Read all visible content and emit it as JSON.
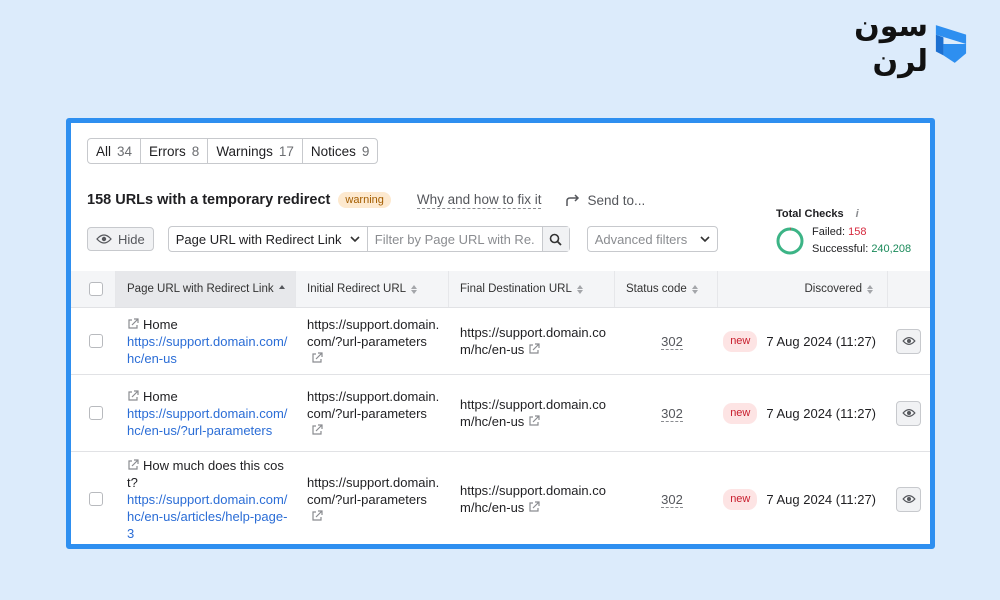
{
  "logo": {
    "text": "سون لرن"
  },
  "tabs": [
    {
      "label": "All",
      "count": "34"
    },
    {
      "label": "Errors",
      "count": "8"
    },
    {
      "label": "Warnings",
      "count": "17"
    },
    {
      "label": "Notices",
      "count": "9"
    }
  ],
  "issue": {
    "title": "158 URLs with a temporary redirect",
    "badge": "warning",
    "why_link": "Why and how to fix it",
    "send_to": "Send to..."
  },
  "total_checks": {
    "title": "Total Checks",
    "info": "i",
    "failed_label": "Failed:",
    "failed_value": "158",
    "successful_label": "Successful:",
    "successful_value": "240,208",
    "failed_fraction": 0.00066
  },
  "toolbar": {
    "hide_label": "Hide",
    "filter_select": "Page URL with Redirect Link",
    "filter_placeholder": "Filter by Page URL with Re...",
    "advanced_filters": "Advanced filters"
  },
  "table": {
    "columns": [
      "Page URL with Redirect Link",
      "Initial Redirect URL",
      "Final Destination URL",
      "Status code",
      "Discovered"
    ],
    "rows": [
      {
        "title": "Home",
        "url": "https://support.domain.com/hc/en-us",
        "initial": "https://support.domain.com/?url-parameters",
        "final": "https://support.domain.com/hc/en-us",
        "status": "302",
        "badge": "new",
        "discovered": "7 Aug 2024 (11:27)"
      },
      {
        "title": "Home",
        "url": "https://support.domain.com/hc/en-us/?url-parameters",
        "initial": "https://support.domain.com/?url-parameters",
        "final": "https://support.domain.com/hc/en-us",
        "status": "302",
        "badge": "new",
        "discovered": "7 Aug 2024 (11:27)"
      },
      {
        "title": "How much does this cost?",
        "url": "https://support.domain.com/hc/en-us/articles/help-page-3",
        "initial": "https://support.domain.com/?url-parameters",
        "final": "https://support.domain.com/hc/en-us",
        "status": "302",
        "badge": "new",
        "discovered": "7 Aug 2024 (11:27)"
      }
    ]
  },
  "colors": {
    "accent": "#2e8ff0",
    "link": "#2b6dd6",
    "warning_bg": "#fde9cf",
    "new_bg": "#fde4e4",
    "success": "#1a8a5a",
    "failed": "#d6293e"
  }
}
